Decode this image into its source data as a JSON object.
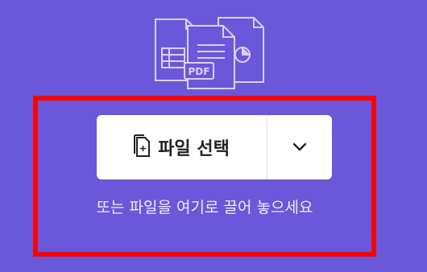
{
  "illustration": {
    "badge_text": "PDF",
    "icon": "documents-illustration-icon"
  },
  "file_picker": {
    "choose_label": "파일 선택",
    "choose_icon": "add-file-icon",
    "dropdown_icon": "chevron-down-icon"
  },
  "drop_hint": "또는 파일을 여기로 끌어 놓으세요",
  "colors": {
    "background": "#6b57da",
    "highlight_border": "#ff0000",
    "button_bg": "#ffffff"
  }
}
